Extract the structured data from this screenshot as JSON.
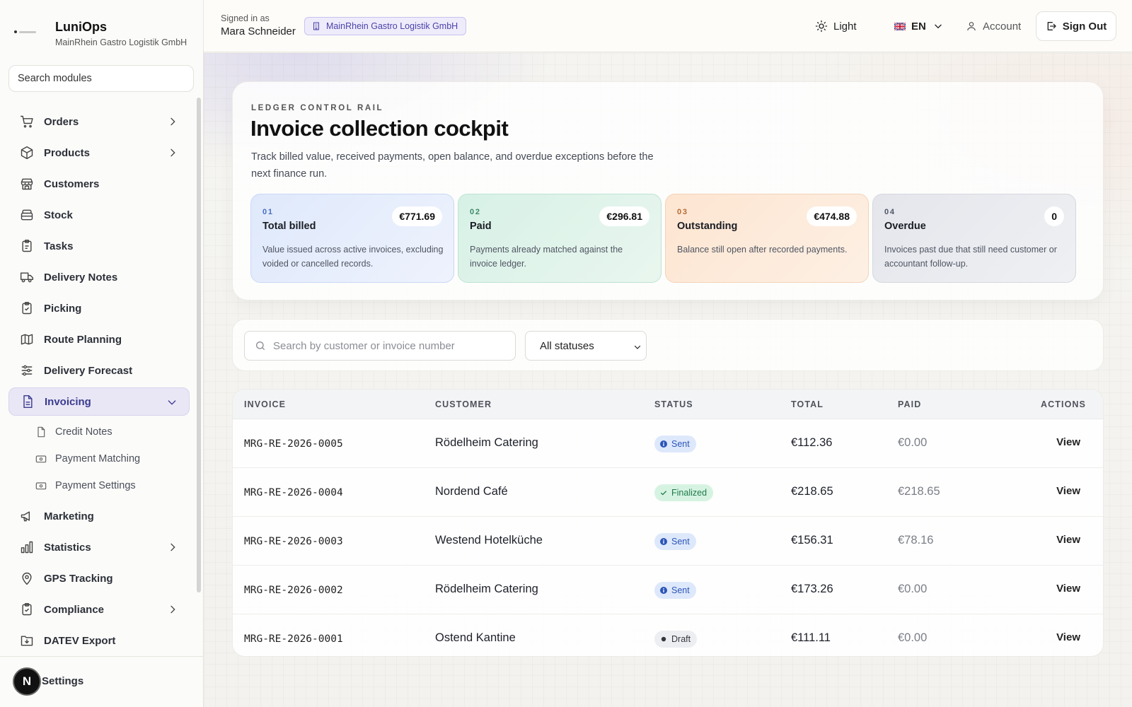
{
  "brand": {
    "name": "LuniOps",
    "company": "MainRhein Gastro Logistik GmbH"
  },
  "sidebar": {
    "search_placeholder": "Search modules",
    "items": [
      {
        "label": "Orders",
        "icon": "cart-icon",
        "chevron": true
      },
      {
        "label": "Products",
        "icon": "box-icon",
        "chevron": true
      },
      {
        "label": "Customers",
        "icon": "store-icon",
        "chevron": false
      },
      {
        "label": "Stock",
        "icon": "stack-icon",
        "chevron": false
      },
      {
        "label": "Tasks",
        "icon": "clipboard-icon",
        "chevron": false
      },
      {
        "label": "Delivery Notes",
        "icon": "truck-icon",
        "chevron": false
      },
      {
        "label": "Picking",
        "icon": "clipboard-check-icon",
        "chevron": false
      },
      {
        "label": "Route Planning",
        "icon": "map-icon",
        "chevron": false
      },
      {
        "label": "Delivery Forecast",
        "icon": "sliders-icon",
        "chevron": false
      },
      {
        "label": "Invoicing",
        "icon": "file-icon",
        "chevron": true,
        "active": true
      },
      {
        "label": "Marketing",
        "icon": "megaphone-icon",
        "chevron": false
      },
      {
        "label": "Statistics",
        "icon": "bar-chart-icon",
        "chevron": true
      },
      {
        "label": "GPS Tracking",
        "icon": "pin-icon",
        "chevron": false
      },
      {
        "label": "Compliance",
        "icon": "clipboard-icon",
        "chevron": true
      },
      {
        "label": "DATEV Export",
        "icon": "folder-download-icon",
        "chevron": false
      }
    ],
    "sub_items": [
      {
        "label": "Credit Notes"
      },
      {
        "label": "Payment Matching"
      },
      {
        "label": "Payment Settings"
      }
    ],
    "footer": {
      "avatar_letter": "N",
      "settings_label": "Settings"
    }
  },
  "topbar": {
    "signed_in_label": "Signed in as",
    "user_name": "Mara Schneider",
    "org_badge": "MainRhein Gastro Logistik GmbH",
    "theme_label": "Light",
    "language": "EN",
    "account_label": "Account",
    "sign_out_label": "Sign Out"
  },
  "hero": {
    "eyebrow": "LEDGER CONTROL RAIL",
    "title": "Invoice collection cockpit",
    "description": "Track billed value, received payments, open balance, and overdue exceptions before the next finance run."
  },
  "kpis": [
    {
      "num": "01",
      "label": "Total billed",
      "value": "€771.69",
      "desc": "Value issued across active invoices, excluding voided or cancelled records."
    },
    {
      "num": "02",
      "label": "Paid",
      "value": "€296.81",
      "desc": "Payments already matched against the invoice ledger."
    },
    {
      "num": "03",
      "label": "Outstanding",
      "value": "€474.88",
      "desc": "Balance still open after recorded payments."
    },
    {
      "num": "04",
      "label": "Overdue",
      "value": "0",
      "desc": "Invoices past due that still need customer or accountant follow-up."
    }
  ],
  "filters": {
    "search_placeholder": "Search by customer or invoice number",
    "status_value": "All statuses"
  },
  "table": {
    "columns": [
      "INVOICE",
      "CUSTOMER",
      "STATUS",
      "TOTAL",
      "PAID",
      "ACTIONS"
    ],
    "rows": [
      {
        "invoice": "MRG-RE-2026-0005",
        "customer": "Rödelheim Catering",
        "status": "Sent",
        "status_type": "sent",
        "total": "€112.36",
        "paid": "€0.00",
        "action": "View"
      },
      {
        "invoice": "MRG-RE-2026-0004",
        "customer": "Nordend Café",
        "status": "Finalized",
        "status_type": "finalized",
        "total": "€218.65",
        "paid": "€218.65",
        "action": "View"
      },
      {
        "invoice": "MRG-RE-2026-0003",
        "customer": "Westend Hotelküche",
        "status": "Sent",
        "status_type": "sent",
        "total": "€156.31",
        "paid": "€78.16",
        "action": "View"
      },
      {
        "invoice": "MRG-RE-2026-0002",
        "customer": "Rödelheim Catering",
        "status": "Sent",
        "status_type": "sent",
        "total": "€173.26",
        "paid": "€0.00",
        "action": "View"
      },
      {
        "invoice": "MRG-RE-2026-0001",
        "customer": "Ostend Kantine",
        "status": "Draft",
        "status_type": "draft",
        "total": "€111.11",
        "paid": "€0.00",
        "action": "View"
      }
    ]
  }
}
